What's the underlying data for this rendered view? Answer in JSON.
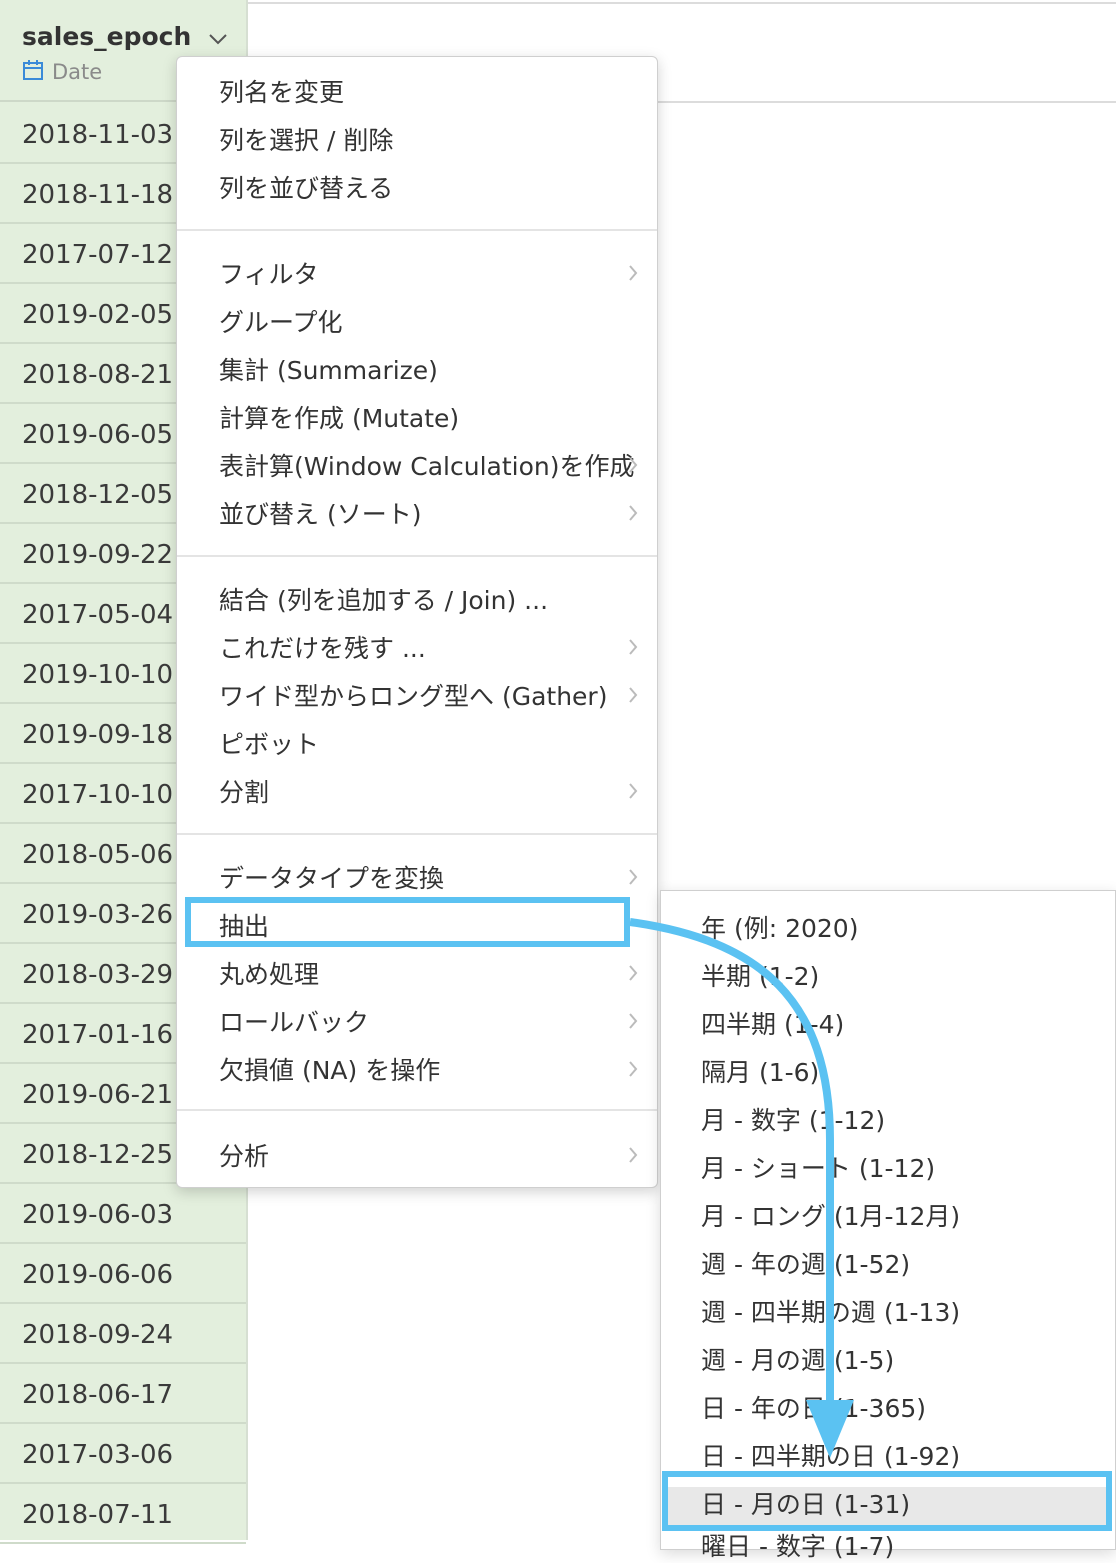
{
  "column": {
    "name": "sales_epoch",
    "type": "Date",
    "values": [
      "2018-11-03",
      "2018-11-18",
      "2017-07-12",
      "2019-02-05",
      "2018-08-21",
      "2019-06-05",
      "2018-12-05",
      "2019-09-22",
      "2017-05-04",
      "2019-10-10",
      "2019-09-18",
      "2017-10-10",
      "2018-05-06",
      "2019-03-26",
      "2018-03-29",
      "2017-01-16",
      "2019-06-21",
      "2018-12-25",
      "2019-06-03",
      "2019-06-06",
      "2018-09-24",
      "2018-06-17",
      "2017-03-06",
      "2018-07-11"
    ]
  },
  "menu": {
    "items": [
      "列名を変更",
      "列を選択 / 削除",
      "列を並び替える",
      "フィルタ",
      "グループ化",
      "集計 (Summarize)",
      "計算を作成 (Mutate)",
      "表計算(Window Calculation)を作成",
      "並び替え (ソート)",
      "結合 (列を追加する / Join) ...",
      "これだけを残す ...",
      "ワイド型からロング型へ (Gather)",
      "ピボット",
      "分割",
      "データタイプを変換",
      "抽出",
      "丸め処理",
      "ロールバック",
      "欠損値 (NA) を操作",
      "分析"
    ]
  },
  "submenu": {
    "items": [
      "年 (例: 2020)",
      "半期 (1-2)",
      "四半期 (1-4)",
      "隔月 (1-6)",
      "月 - 数字 (1-12)",
      "月 - ショート (1-12)",
      "月 - ロング (1月-12月)",
      "週 - 年の週 (1-52)",
      "週 - 四半期の週 (1-13)",
      "週 - 月の週 (1-5)",
      "日 - 年の日 (1-365)",
      "日 - 四半期の日 (1-92)",
      "日 - 月の日 (1-31)",
      "曜日 - 数字 (1-7)"
    ]
  },
  "colors": {
    "accent": "#5bc2f2",
    "column_bg": "#e3efdd",
    "type_icon": "#3a8ad8"
  }
}
